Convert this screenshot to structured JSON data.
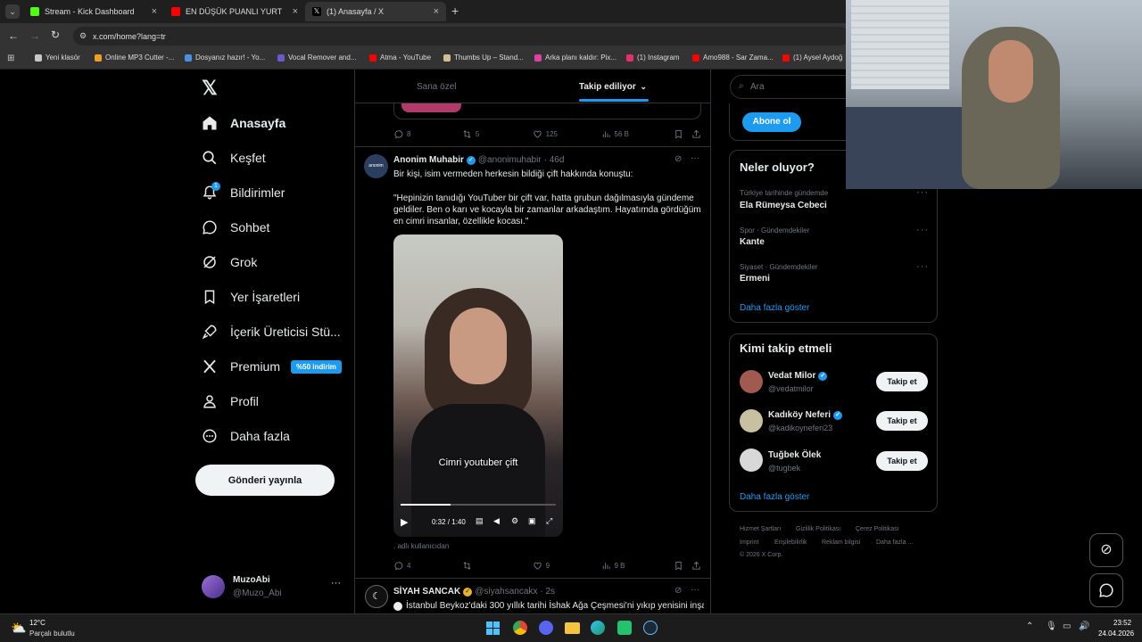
{
  "browser": {
    "tabs": [
      {
        "label": "Stream - Kick Dashboard",
        "color": "#53fc18"
      },
      {
        "label": "EN DÜŞÜK PUANLI YURT DIŞI T",
        "color": "#ff0000"
      },
      {
        "label": "(1) Anasayfa / X",
        "color": "#ffffff"
      }
    ],
    "url": "x.com/home?lang=tr",
    "bookmarks": [
      {
        "label": "Yeni klasör",
        "color": "#c8c8c8"
      },
      {
        "label": "Online MP3 Cutter -...",
        "color": "#f0a020"
      },
      {
        "label": "Dosyanız hazır! - Yo...",
        "color": "#4a90e2"
      },
      {
        "label": "Vocal Remover and...",
        "color": "#6a5acd"
      },
      {
        "label": "Atma - YouTube",
        "color": "#ff0000"
      },
      {
        "label": "Thumbs Up – Stand...",
        "color": "#d0c090"
      },
      {
        "label": "Arka planı kaldır: Pix...",
        "color": "#e040a0"
      },
      {
        "label": "(1) Instagram",
        "color": "#e1306c"
      },
      {
        "label": "Amo988 - Sar Zama...",
        "color": "#ff0000"
      },
      {
        "label": "(1) Aysel Aydoğ",
        "color": "#ff0000"
      }
    ]
  },
  "nav": {
    "items": [
      {
        "label": "Anasayfa",
        "icon": "home-icon"
      },
      {
        "label": "Keşfet",
        "icon": "search-icon"
      },
      {
        "label": "Bildirimler",
        "icon": "bell-icon",
        "badge": "1"
      },
      {
        "label": "Sohbet",
        "icon": "chat-icon"
      },
      {
        "label": "Grok",
        "icon": "grok-icon"
      },
      {
        "label": "Yer İşaretleri",
        "icon": "bookmark-icon"
      },
      {
        "label": "İçerik Üreticisi Stü...",
        "icon": "rocket-icon"
      },
      {
        "label": "Premium",
        "icon": "x-logo-icon",
        "badge": "%50 indirim"
      },
      {
        "label": "Profil",
        "icon": "person-icon"
      },
      {
        "label": "Daha fazla",
        "icon": "more-circle-icon"
      }
    ],
    "post_button": "Gönderi yayınla",
    "account": {
      "name": "MuzoAbi",
      "handle": "@Muzo_Abi"
    }
  },
  "feed": {
    "tabs": [
      "Sana özel",
      "Takip ediliyor"
    ],
    "prev_stats": {
      "replies": "8",
      "reposts": "5",
      "likes": "125",
      "views": "56 B"
    },
    "tweet": {
      "author": "Anonim Muhabir",
      "handle": "@anonimuhabir",
      "time": "· 46d",
      "line1": "Bir kişi, isim vermeden herkesin bildiği çift hakkında konuştu:",
      "quote": "\"Hepinizin tanıdığı YouTuber bir çift var, hatta grubun dağılmasıyla gündeme geldiler. Ben o karı ve kocayla bir zamanlar arkadaştım. Hayatımda gördüğüm en cimri insanlar, özellikle kocası.\"",
      "video_caption": "Cimri youtuber çift",
      "video_time": "0:32 / 1:40",
      "video_progress": 0.32,
      "source": ". adlı kullanıcıdan",
      "stats": {
        "replies": "4",
        "reposts": "",
        "likes": "9",
        "views": "9 B"
      }
    },
    "next_tweet": {
      "author": "SİYAH SANCAK",
      "handle": "@siyahsancakx",
      "time": "· 2s",
      "text": "İstanbul Beykoz'daki 300 yıllık tarihi İshak Ağa Çeşmesi'ni yıkıp yenisini inşa"
    }
  },
  "right": {
    "search_placeholder": "Ara",
    "subscribe": "Abone ol",
    "trends_title": "Neler oluyor?",
    "trends": [
      {
        "category": "Türkiye tarihinde gündemde",
        "title": "Ela Rümeysa Cebeci"
      },
      {
        "category": "Spor · Gündemdekiler",
        "title": "Kante"
      },
      {
        "category": "Siyaset · Gündemdekiler",
        "title": "Ermeni"
      }
    ],
    "show_more": "Daha fazla göster",
    "who_to_follow_title": "Kimi takip etmeli",
    "suggestions": [
      {
        "name": "Vedat Milor",
        "handle": "@vedatmilor",
        "verified": true,
        "button": "Takip et"
      },
      {
        "name": "Kadıköy Neferi",
        "handle": "@kadikoyneferi23",
        "verified": true,
        "button": "Takip et"
      },
      {
        "name": "Tuğbek Ölek",
        "handle": "@tugbek",
        "verified": false,
        "button": "Takip et"
      }
    ],
    "show_more_2": "Daha fazla göster",
    "footer": [
      "Hizmet Şartları",
      "Gizlilik Politikası",
      "Çerez Politikası",
      "Imprint",
      "Erişilebilirlik",
      "Reklam bilgisi",
      "Daha fazla ...",
      "© 2026 X Corp."
    ]
  },
  "taskbar": {
    "weather_temp": "12°C",
    "weather_desc": "Parçalı bulutlu",
    "time": "23:52",
    "date": "24.04.2026"
  },
  "colors": {
    "accent": "#1d9bf0",
    "bg": "#000000",
    "border": "#2f3336",
    "muted": "#71767b"
  }
}
